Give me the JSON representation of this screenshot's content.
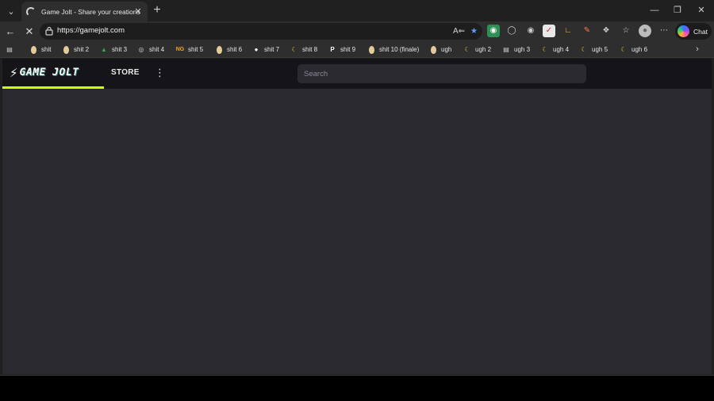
{
  "browser": {
    "tab": {
      "title": "Game Jolt - Share your creations"
    },
    "address": {
      "url": "https://gamejolt.com"
    },
    "chat_label": "Chat",
    "bookmarks": [
      {
        "label": "shit",
        "icon": "potato-icon"
      },
      {
        "label": "shit 2",
        "icon": "potato-icon"
      },
      {
        "label": "shit 3",
        "icon": "google-drive-icon"
      },
      {
        "label": "shit 4",
        "icon": "globe-icon"
      },
      {
        "label": "shit 5",
        "icon": "ng-icon"
      },
      {
        "label": "shit 6",
        "icon": "potato-icon"
      },
      {
        "label": "shit 7",
        "icon": "github-icon"
      },
      {
        "label": "shit 8",
        "icon": "banana-icon"
      },
      {
        "label": "shit 9",
        "icon": "p-icon"
      },
      {
        "label": "shit 10 (finale)",
        "icon": "potato-icon"
      },
      {
        "label": "ugh",
        "icon": "potato-icon"
      },
      {
        "label": "ugh 2",
        "icon": "banana-icon"
      },
      {
        "label": "ugh 3",
        "icon": "document-icon"
      },
      {
        "label": "ugh 4",
        "icon": "banana-icon"
      },
      {
        "label": "ugh 5",
        "icon": "banana-icon"
      },
      {
        "label": "ugh 6",
        "icon": "banana-icon"
      }
    ]
  },
  "site": {
    "logo_text": "GAME JOLT",
    "nav": {
      "store_label": "STORE"
    },
    "search": {
      "placeholder": "Search"
    },
    "accent_color": "#ccff00"
  }
}
